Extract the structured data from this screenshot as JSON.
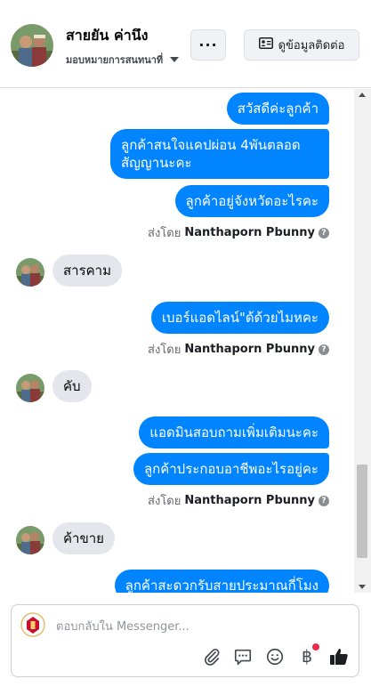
{
  "header": {
    "contact_name": "สายยัน ค่านึง",
    "assign_label": "มอบหมายการสนทนาที่",
    "more_label": "···",
    "info_button_label": "ดูข้อมูลติดต่อ"
  },
  "thread": {
    "sent_by_prefix": "ส่งโดย",
    "sender_name": "Nanthaporn Pbunny",
    "help_glyph": "?",
    "group1": [
      "สวัสดีค่ะลูกค้า",
      "ลูกค้าสนใจแคปผ่อน 4พันตลอด สัญญานะคะ",
      "ลูกค้าอยู่จังหวัดอะไรคะ"
    ],
    "incoming1": "สารคาม",
    "group2": [
      "เบอร์แอดไลน์\"ด้ด้วยไมหคะ"
    ],
    "incoming2": "คับ",
    "group3": [
      "แอดมินสอบถามเพิ่มเติมนะคะ",
      "ลูกค้าประกอบอาชีพอะไรอยู่คะ"
    ],
    "incoming3": "ค้าขาย",
    "group4": [
      "ลูกค้าสะดวกรับสายประมาณกี่โมง"
    ]
  },
  "composer": {
    "placeholder": "ตอบกลับใน Messenger...",
    "baht_symbol": "฿",
    "icons": [
      "paperclip-icon",
      "chat-bubble-icon",
      "smiley-icon",
      "baht-icon",
      "thumbs-up-icon"
    ]
  },
  "colors": {
    "outgoing_bubble": "#0084ff",
    "incoming_bubble": "#e4e6eb",
    "notification_dot": "#f02849"
  }
}
